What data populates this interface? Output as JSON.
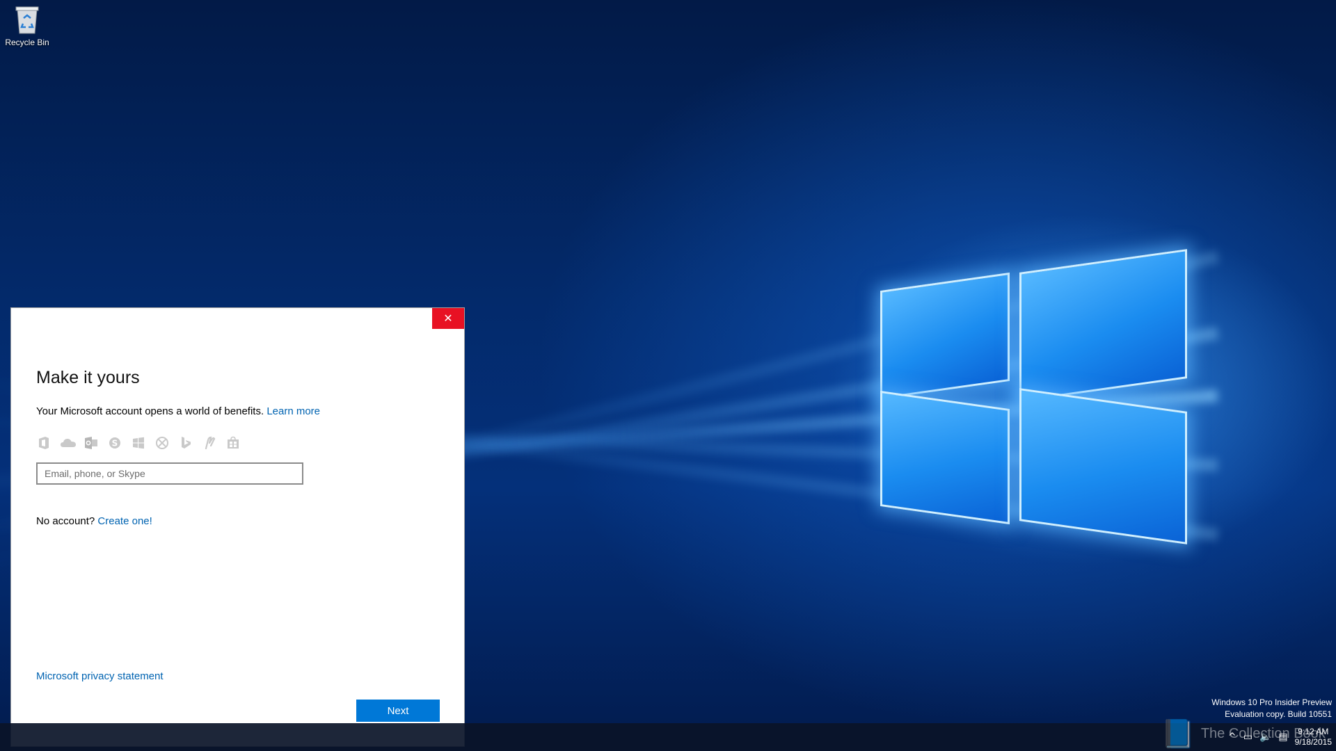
{
  "desktop": {
    "recycle_bin_label": "Recycle Bin"
  },
  "dialog": {
    "close_glyph": "✕",
    "title": "Make it yours",
    "subtitle_text": "Your Microsoft account opens a world of benefits.",
    "learn_more": "Learn more",
    "service_icons": [
      "office-icon",
      "onedrive-icon",
      "outlook-icon",
      "skype-icon",
      "windows-icon",
      "xbox-icon",
      "bing-icon",
      "msn-icon",
      "store-icon"
    ],
    "email_placeholder": "Email, phone, or Skype",
    "no_account_text": "No account?",
    "create_one": "Create one!",
    "privacy_link": "Microsoft privacy statement",
    "next_label": "Next",
    "accent_color": "#0078d7",
    "close_color": "#e81123"
  },
  "watermark": {
    "line1": "Windows 10 Pro Insider Preview",
    "line2": "Evaluation copy. Build 10551"
  },
  "overlay": {
    "text": "The Collection Book"
  },
  "taskbar": {
    "time": "9:12 AM",
    "date": "9/18/2015"
  }
}
